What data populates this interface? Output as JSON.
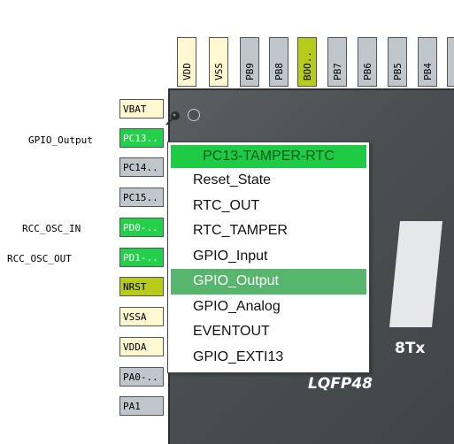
{
  "chip": {
    "part_suffix": "8Tx",
    "package": "LQFP48"
  },
  "top_pins": [
    {
      "label": "VDD",
      "color": "#fff7cf"
    },
    {
      "label": "VSS",
      "color": "#fff7cf"
    },
    {
      "label": "PB9",
      "color": "#bfc7cc"
    },
    {
      "label": "PB8",
      "color": "#bfc7cc"
    },
    {
      "label": "BOO..",
      "color": "#b7cb1b"
    },
    {
      "label": "PB7",
      "color": "#bfc7cc"
    },
    {
      "label": "PB6",
      "color": "#bfc7cc"
    },
    {
      "label": "PB5",
      "color": "#bfc7cc"
    },
    {
      "label": "PB4",
      "color": "#bfc7cc"
    },
    {
      "label": "",
      "color": "#bfc7cc"
    }
  ],
  "left_pins": [
    {
      "label": "VBAT",
      "color": "#fff7cf"
    },
    {
      "label": "PC13..",
      "color": "#23d04a"
    },
    {
      "label": "PC14..",
      "color": "#bfc7cc"
    },
    {
      "label": "PC15..",
      "color": "#bfc7cc"
    },
    {
      "label": "PD0-..",
      "color": "#23d04a"
    },
    {
      "label": "PD1-..",
      "color": "#23d04a"
    },
    {
      "label": "NRST",
      "color": "#b7cb1b"
    },
    {
      "label": "VSSA",
      "color": "#fff7cf"
    },
    {
      "label": "VDDA",
      "color": "#fff7cf"
    },
    {
      "label": "PA0-..",
      "color": "#bfc7cc"
    },
    {
      "label": "PA1",
      "color": "#bfc7cc"
    }
  ],
  "signal_labels": {
    "pc13": "GPIO_Output",
    "pd0": "RCC_OSC_IN",
    "pd1": "RCC_OSC_OUT"
  },
  "menu": {
    "title": "PC13-TAMPER-RTC",
    "items": [
      "Reset_State",
      "RTC_OUT",
      "RTC_TAMPER",
      "GPIO_Input",
      "GPIO_Output",
      "GPIO_Analog",
      "EVENTOUT",
      "GPIO_EXTI13"
    ],
    "selected": "GPIO_Output"
  }
}
